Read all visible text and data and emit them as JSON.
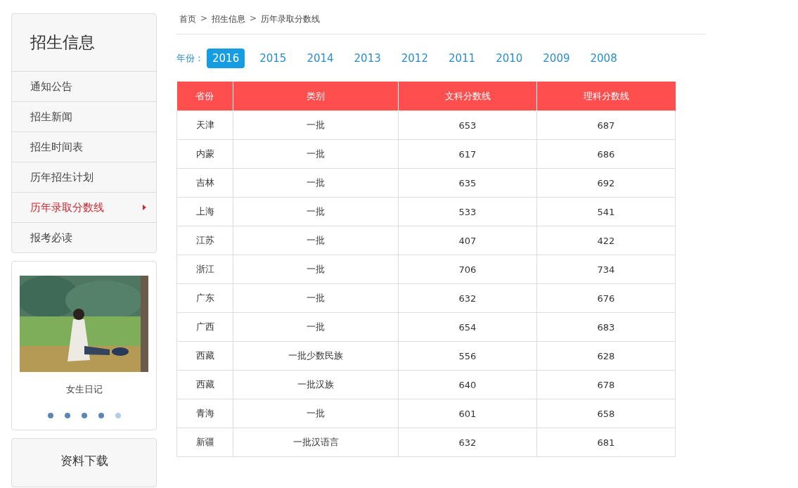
{
  "sidebar": {
    "title": "招生信息",
    "items": [
      {
        "label": "通知公告",
        "selected": false
      },
      {
        "label": "招生新闻",
        "selected": false
      },
      {
        "label": "招生时间表",
        "selected": false
      },
      {
        "label": "历年招生计划",
        "selected": false
      },
      {
        "label": "历年录取分数线",
        "selected": true
      },
      {
        "label": "报考必读",
        "selected": false
      }
    ]
  },
  "carousel": {
    "caption": "女生日记",
    "dots": [
      {
        "selected": false
      },
      {
        "selected": false
      },
      {
        "selected": false
      },
      {
        "selected": false
      },
      {
        "selected": true
      }
    ]
  },
  "downloads": {
    "title": "资料下载"
  },
  "breadcrumb": {
    "separator": ">",
    "items": [
      "首页",
      "招生信息",
      "历年录取分数线"
    ]
  },
  "years": {
    "label": "年份：",
    "items": [
      {
        "label": "2016",
        "selected": true
      },
      {
        "label": "2015",
        "selected": false
      },
      {
        "label": "2014",
        "selected": false
      },
      {
        "label": "2013",
        "selected": false
      },
      {
        "label": "2012",
        "selected": false
      },
      {
        "label": "2011",
        "selected": false
      },
      {
        "label": "2010",
        "selected": false
      },
      {
        "label": "2009",
        "selected": false
      },
      {
        "label": "2008",
        "selected": false
      }
    ]
  },
  "table": {
    "columns": [
      "省份",
      "类别",
      "文科分数线",
      "理科分数线"
    ],
    "rows": [
      [
        "天津",
        "一批",
        "653",
        "687"
      ],
      [
        "内蒙",
        "一批",
        "617",
        "686"
      ],
      [
        "吉林",
        "一批",
        "635",
        "692"
      ],
      [
        "上海",
        "一批",
        "533",
        "541"
      ],
      [
        "江苏",
        "一批",
        "407",
        "422"
      ],
      [
        "浙江",
        "一批",
        "706",
        "734"
      ],
      [
        "广东",
        "一批",
        "632",
        "676"
      ],
      [
        "广西",
        "一批",
        "654",
        "683"
      ],
      [
        "西藏",
        "一批少数民族",
        "556",
        "628"
      ],
      [
        "西藏",
        "一批汉族",
        "640",
        "678"
      ],
      [
        "青海",
        "一批",
        "601",
        "658"
      ],
      [
        "新疆",
        "一批汉语言",
        "632",
        "681"
      ]
    ]
  }
}
